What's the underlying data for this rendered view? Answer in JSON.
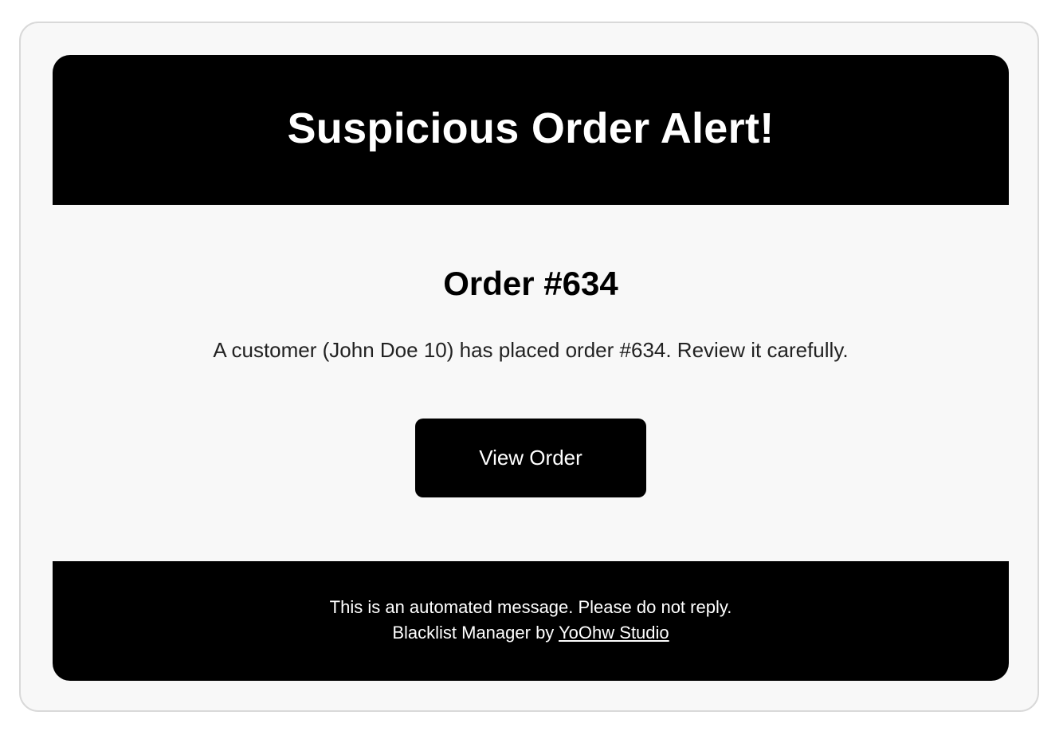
{
  "header": {
    "title": "Suspicious Order Alert!"
  },
  "order": {
    "title": "Order #634",
    "description": "A customer (John Doe 10) has placed order #634. Review it carefully.",
    "button_label": "View Order"
  },
  "footer": {
    "notice": "This is an automated message. Please do not reply.",
    "credit_prefix": "Blacklist Manager by ",
    "credit_link": "YoOhw Studio"
  },
  "colors": {
    "header_background": "#000000",
    "card_background": "#f8f8f8",
    "button_background": "#000000",
    "footer_background": "#000000",
    "text_primary": "#000000",
    "text_on_dark": "#ffffff"
  }
}
